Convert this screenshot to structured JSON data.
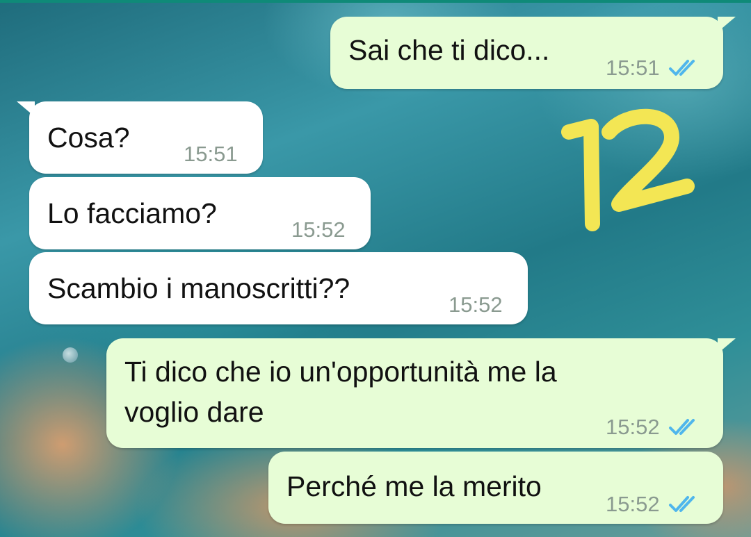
{
  "messages": [
    {
      "direction": "outgoing",
      "text": "Sai che ti dico...",
      "time": "15:51",
      "read_ticks": "double-check-icon"
    },
    {
      "direction": "incoming",
      "text": "Cosa?",
      "time": "15:51"
    },
    {
      "direction": "incoming",
      "text": "Lo facciamo?",
      "time": "15:52"
    },
    {
      "direction": "incoming",
      "text": "Scambio i manoscritti??",
      "time": "15:52"
    },
    {
      "direction": "outgoing",
      "text_line1": "Ti dico che io un'opportunità me la",
      "text_line2": "voglio dare",
      "time": "15:52",
      "read_ticks": "double-check-icon"
    },
    {
      "direction": "outgoing",
      "text": "Perché me la merito",
      "time": "15:52",
      "read_ticks": "double-check-icon"
    }
  ],
  "overlay": {
    "number": "12",
    "color": "#f3e654"
  },
  "colors": {
    "outgoing_bubble": "#e7fdd6",
    "incoming_bubble": "#ffffff",
    "tick_color": "#4fb6ec"
  }
}
